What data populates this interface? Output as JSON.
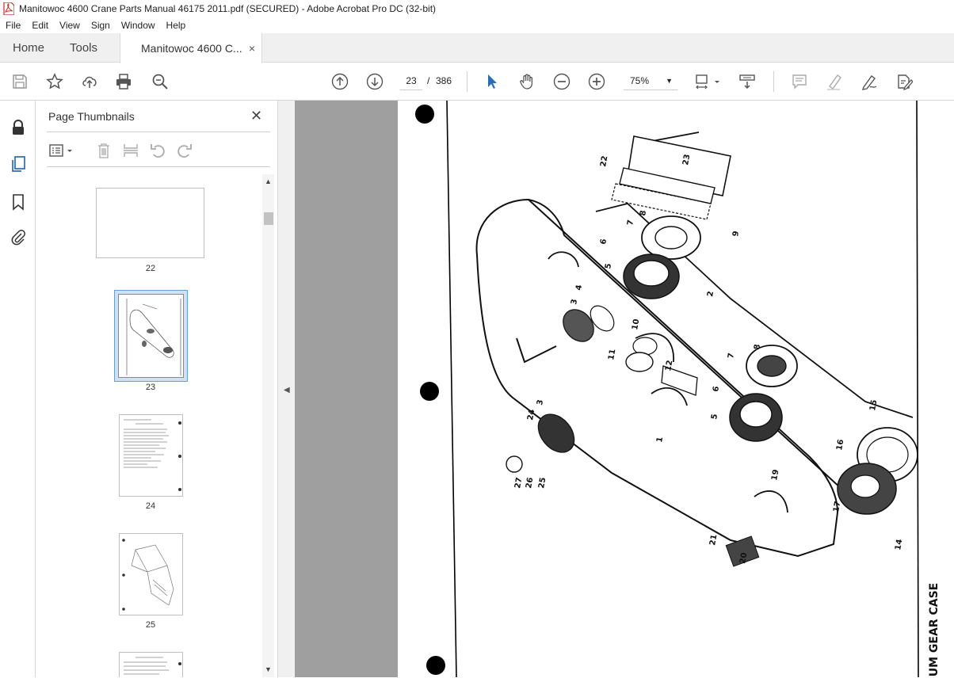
{
  "window": {
    "title": "Manitowoc 4600 Crane Parts Manual 46175 2011.pdf (SECURED) - Adobe Acrobat Pro DC (32-bit)"
  },
  "menu": [
    "File",
    "Edit",
    "View",
    "Sign",
    "Window",
    "Help"
  ],
  "tabs": {
    "home": "Home",
    "tools": "Tools",
    "document": "Manitowoc 4600 C...",
    "close": "×"
  },
  "toolbar": {
    "current_page": "23",
    "separator": "/",
    "total_pages": "386",
    "zoom": "75%"
  },
  "panel": {
    "title": "Page Thumbnails",
    "close": "✕",
    "thumbnails": [
      {
        "label": "22",
        "selected": false
      },
      {
        "label": "23",
        "selected": true
      },
      {
        "label": "24",
        "selected": false
      },
      {
        "label": "25",
        "selected": false
      }
    ]
  },
  "document_page": {
    "caption": "UM GEAR CASE",
    "part_numbers": [
      "1",
      "2",
      "3",
      "3",
      "4",
      "5",
      "5",
      "6",
      "6",
      "7",
      "7",
      "8",
      "8",
      "9",
      "10",
      "11",
      "12",
      "14",
      "15",
      "16",
      "17",
      "19",
      "20",
      "21",
      "22",
      "23",
      "24",
      "25",
      "26",
      "27"
    ]
  },
  "colors": {
    "accent": "#2a6db5",
    "viewer_bg": "#9f9f9f"
  }
}
